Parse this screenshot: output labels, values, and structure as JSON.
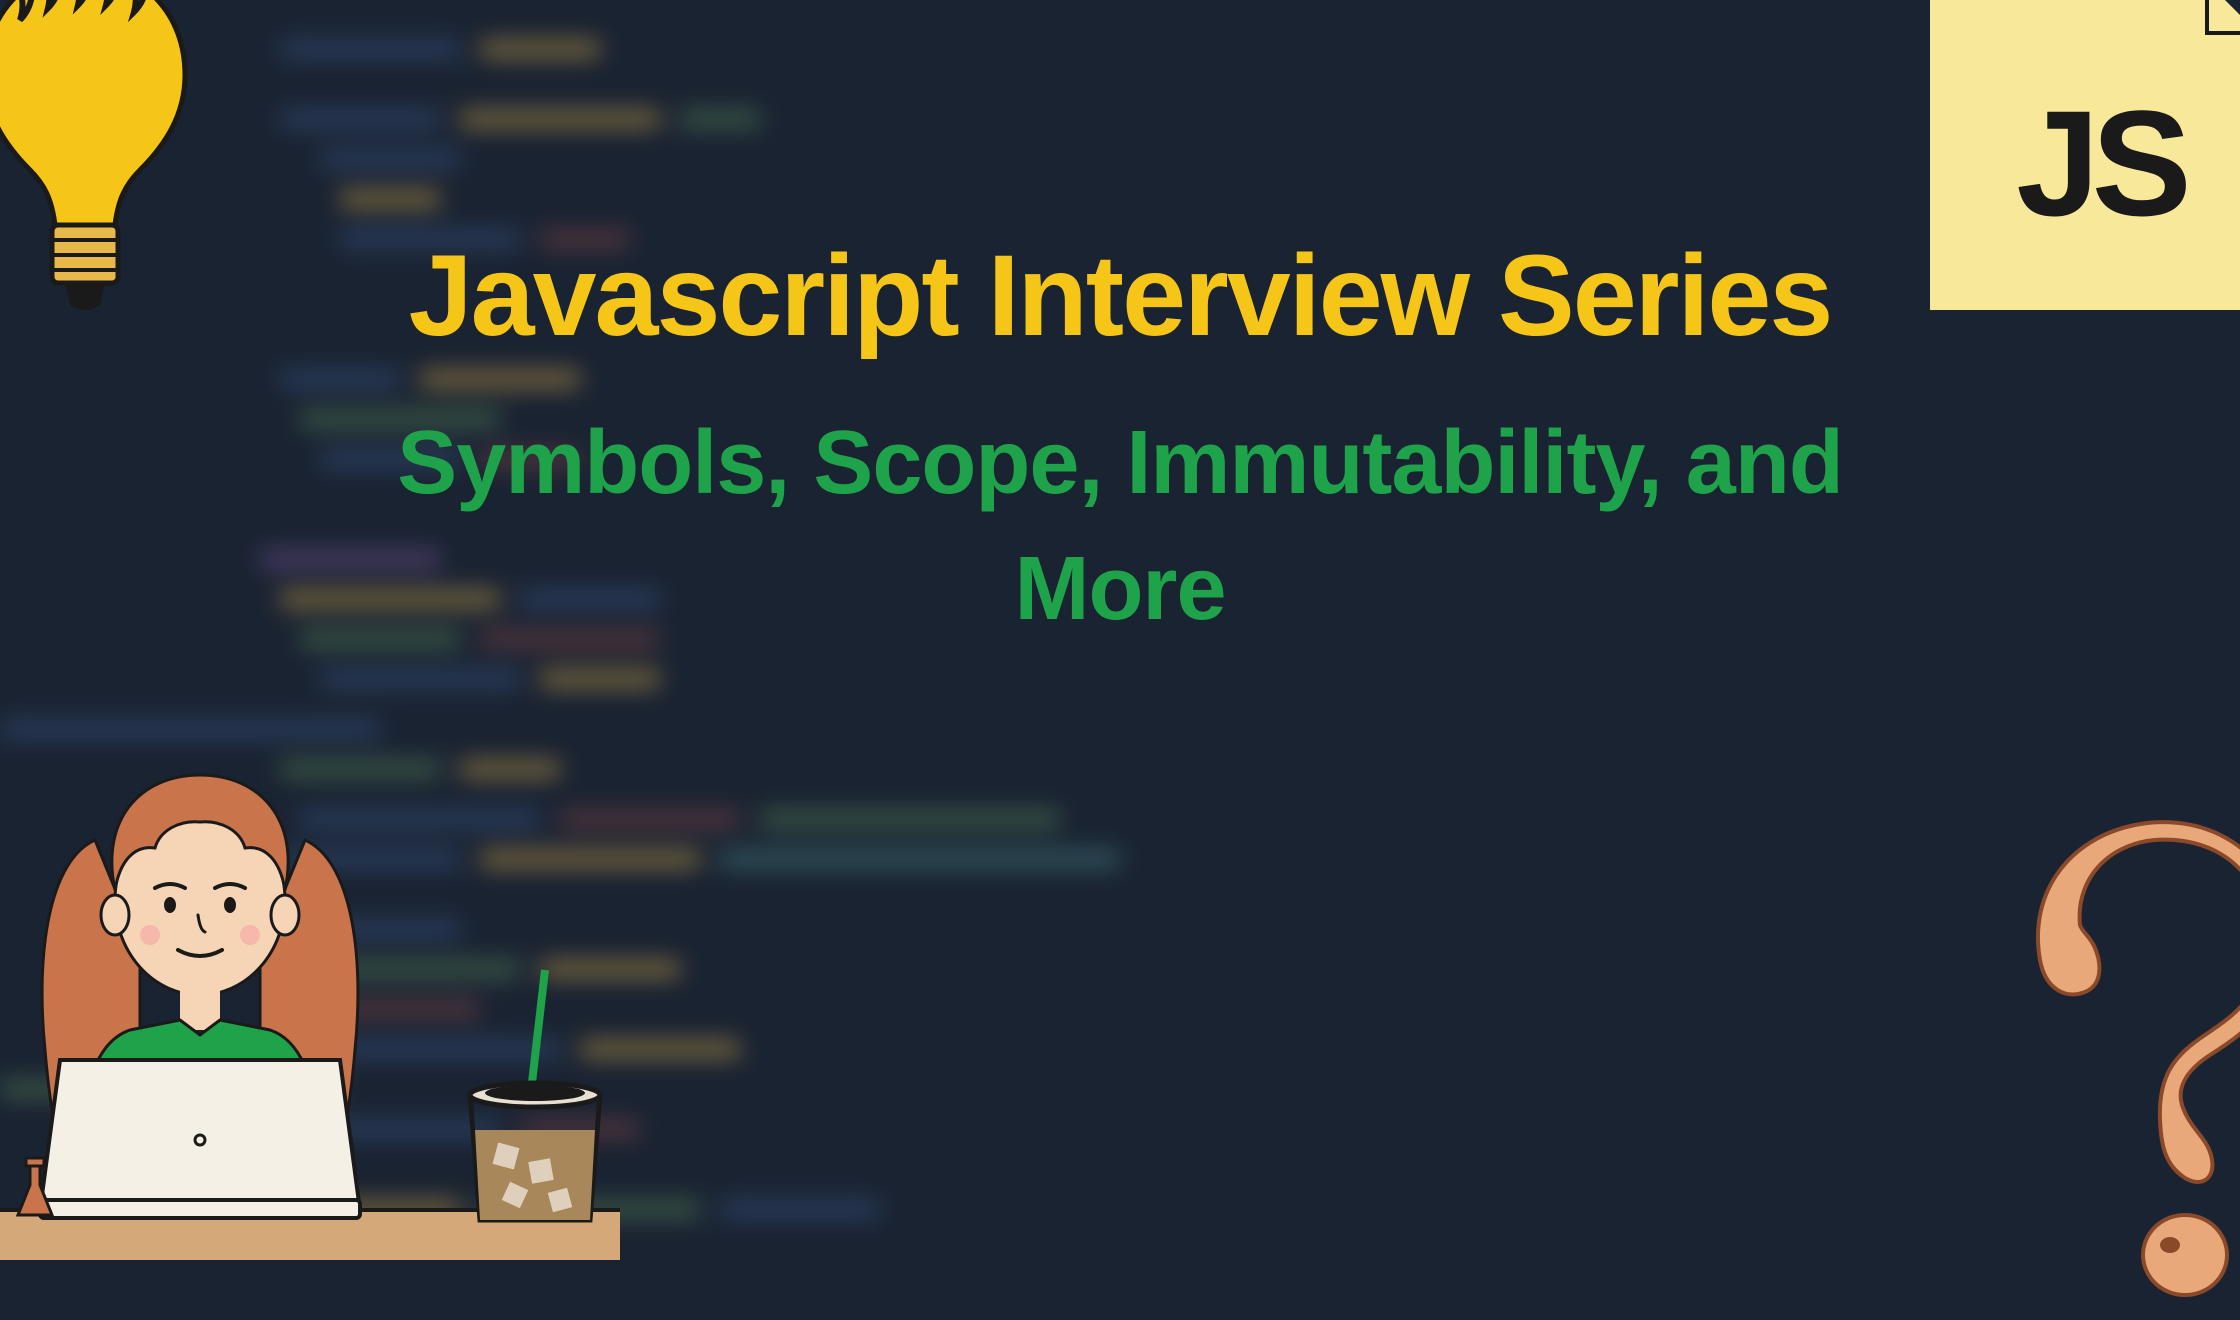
{
  "title": "Javascript Interview Series",
  "subtitle": "Symbols, Scope, Immutability, and More",
  "badge_text": "JS"
}
